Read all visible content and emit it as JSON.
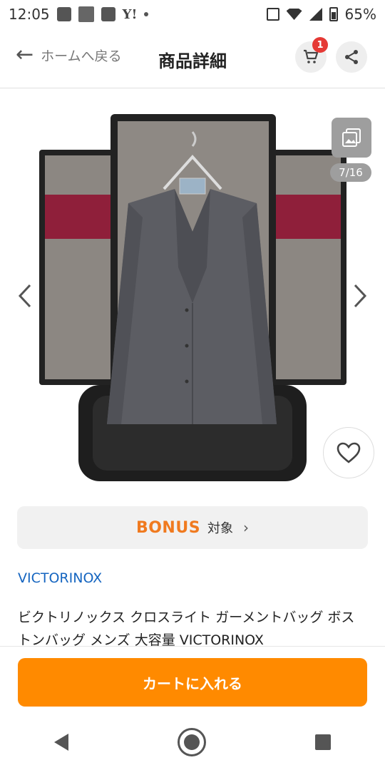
{
  "status_bar": {
    "time": "12:05",
    "carrier_text": "Y!",
    "battery": "65%"
  },
  "header": {
    "back_label": "ホームへ戻る",
    "title": "商品詳細",
    "cart_badge": "1"
  },
  "gallery": {
    "counter": "7/16"
  },
  "bonus": {
    "logo": "BONUS",
    "label": "対象"
  },
  "product": {
    "brand": "VICTORINOX",
    "title": "ビクトリノックス クロスライト ガーメントバッグ ボストンバッグ メンズ 大容量 VICTORINOX"
  },
  "cta": {
    "add_to_cart": "カートに入れる"
  },
  "colors": {
    "accent_orange": "#ff8a00",
    "bonus_orange": "#f07a1f",
    "link_blue": "#1565c0",
    "badge_red": "#e53935"
  }
}
